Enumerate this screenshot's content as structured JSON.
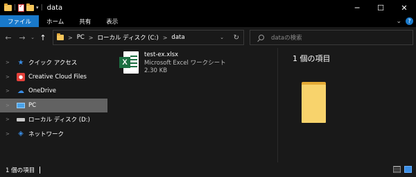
{
  "window": {
    "title": "data",
    "controls": {
      "minimize": "─",
      "maximize": "☐",
      "close": "✕"
    }
  },
  "quick_access_toolbar": {
    "separator": "|",
    "dropdown": "▾",
    "separator2": "|"
  },
  "ribbon": {
    "tabs": [
      {
        "label": "ファイル",
        "active": true
      },
      {
        "label": "ホーム",
        "active": false
      },
      {
        "label": "共有",
        "active": false
      },
      {
        "label": "表示",
        "active": false
      }
    ],
    "expand_icon": "⌄",
    "help_icon": "?"
  },
  "nav": {
    "back": "←",
    "forward": "→",
    "recent": "⌄",
    "up": "↑"
  },
  "address": {
    "crumbs": [
      "PC",
      "ローカル ディスク (C:)",
      "data"
    ],
    "separator": ">",
    "dropdown": "⌄",
    "refresh": "↻"
  },
  "search": {
    "placeholder": "dataの検索"
  },
  "sidebar": {
    "items": [
      {
        "label": "クイック アクセス",
        "icon": "star-icon",
        "selected": false
      },
      {
        "label": "Creative Cloud Files",
        "icon": "creative-cloud-icon",
        "selected": false
      },
      {
        "label": "OneDrive",
        "icon": "cloud-icon",
        "selected": false
      },
      {
        "label": "PC",
        "icon": "pc-icon",
        "selected": true
      },
      {
        "label": "ローカル ディスク (D:)",
        "icon": "drive-icon",
        "selected": false
      },
      {
        "label": "ネットワーク",
        "icon": "network-icon",
        "selected": false
      }
    ],
    "expander": ">"
  },
  "files": [
    {
      "name": "test-ex.xlsx",
      "type": "Microsoft Excel ワークシート",
      "size": "2.30 KB",
      "icon": "excel-icon"
    }
  ],
  "excel_badge": "X",
  "preview": {
    "count_label": "1 個の項目"
  },
  "status": {
    "text": "1 個の項目"
  },
  "colors": {
    "accent": "#1979ca",
    "background": "#191919",
    "selection": "#626262",
    "folder": "#f8d36c",
    "excel_green": "#1d6f42"
  }
}
